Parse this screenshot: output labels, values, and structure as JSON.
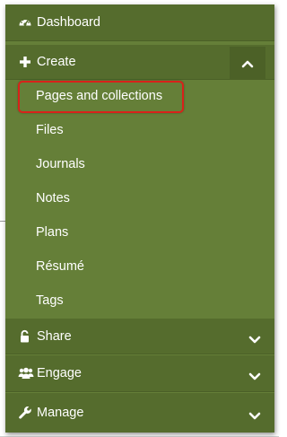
{
  "menu": {
    "dashboard": {
      "label": "Dashboard",
      "icon": "dashboard-gauge-icon"
    },
    "create": {
      "label": "Create",
      "icon": "plus-icon",
      "expanded": true,
      "toggle_icon": "chevron-up-icon",
      "items": [
        {
          "label": "Pages and collections",
          "highlighted": true
        },
        {
          "label": "Files"
        },
        {
          "label": "Journals"
        },
        {
          "label": "Notes"
        },
        {
          "label": "Plans"
        },
        {
          "label": "Résumé"
        },
        {
          "label": "Tags"
        }
      ]
    },
    "share": {
      "label": "Share",
      "icon": "unlock-icon",
      "toggle_icon": "chevron-down-icon"
    },
    "engage": {
      "label": "Engage",
      "icon": "users-icon",
      "toggle_icon": "chevron-down-icon"
    },
    "manage": {
      "label": "Manage",
      "icon": "wrench-icon",
      "toggle_icon": "chevron-down-icon"
    }
  },
  "colors": {
    "menu_bg": "#657f38",
    "top_row_bg": "#556c2d",
    "highlight_border": "#d8221a",
    "text": "#ffffff"
  }
}
